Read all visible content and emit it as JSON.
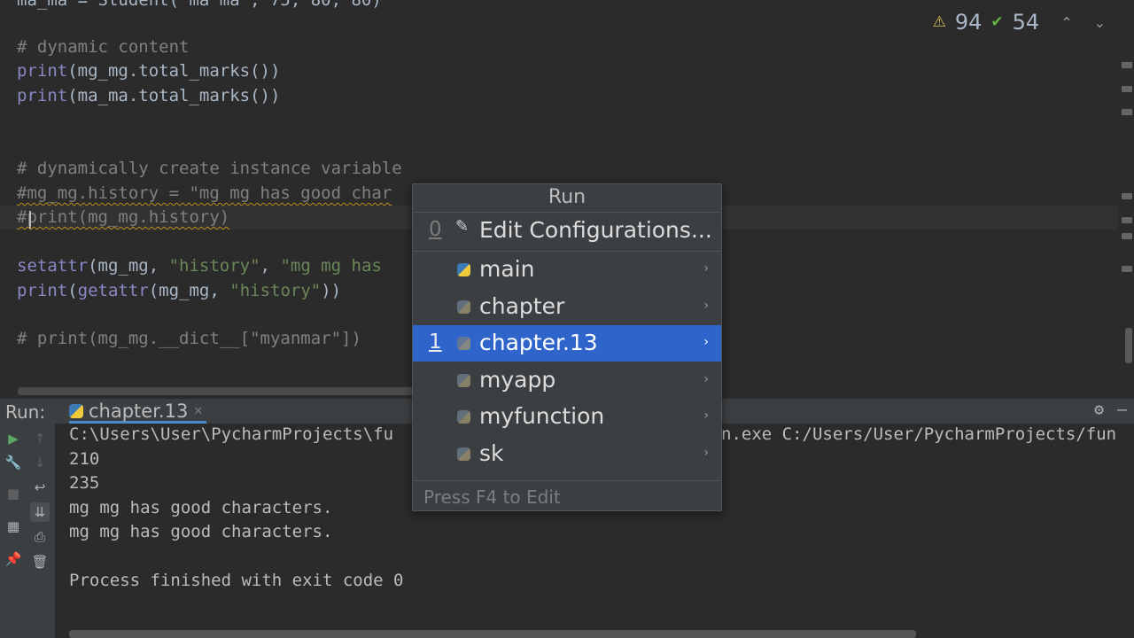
{
  "editor": {
    "lines": [
      {
        "text": "ma_ma = Student(\"ma ma\", 75, 80, 80)"
      },
      {
        "text": "# dynamic content"
      },
      {
        "kw": "print",
        "rest": "(mg_mg.total_marks())"
      },
      {
        "kw": "print",
        "rest": "(ma_ma.total_marks())"
      },
      {
        "text": "# dynamically create instance variable"
      },
      {
        "text": "#mg_mg.history = \"mg mg has good char"
      },
      {
        "text": "#print(mg_mg.history)"
      },
      {
        "kw": "setattr",
        "rest": "(mg_mg, ",
        "str": "\"history\"",
        "rest2": ", ",
        "str2": "\"mg mg has"
      },
      {
        "kw": "print",
        "rest": "(",
        "kw2": "getattr",
        "rest2": "(mg_mg, ",
        "str": "\"history\"",
        "rest3": "))"
      },
      {
        "text": "# print(mg_mg.__dict__[\"myanmar\"])"
      }
    ],
    "inspections": {
      "warnings_icon": "warning-triangle-icon",
      "warnings_count": "94",
      "weak_icon": "check-icon",
      "weak_count": "54"
    }
  },
  "run_panel": {
    "label": "Run:",
    "tab_label": "chapter.13",
    "output": [
      "C:\\Users\\User\\PycharmProjects\\fu",
      "n.exe C:/Users/User/PycharmProjects/fun",
      "210",
      "235",
      "mg mg has good characters.",
      "mg mg has good characters.",
      "Process finished with exit code 0"
    ]
  },
  "popup": {
    "title": "Run",
    "items": [
      {
        "number": "0",
        "label": "Edit Configurations...",
        "icon": "pencil-icon"
      },
      {
        "number": "",
        "label": "main",
        "icon": "python-icon"
      },
      {
        "number": "",
        "label": "chapter",
        "icon": "python-icon"
      },
      {
        "number": "1",
        "label": "chapter.13",
        "icon": "python-icon",
        "selected": true
      },
      {
        "number": "",
        "label": "myapp",
        "icon": "python-icon"
      },
      {
        "number": "",
        "label": "myfunction",
        "icon": "python-icon"
      },
      {
        "number": "",
        "label": "sk",
        "icon": "python-icon"
      }
    ],
    "footer": "Press F4 to Edit"
  },
  "colors": {
    "editor_bg": "#2b2b2b",
    "panel_bg": "#3c3f41",
    "selection": "#2f65ca",
    "keyword": "#8888c6",
    "string": "#6a8759",
    "comment": "#808080"
  }
}
